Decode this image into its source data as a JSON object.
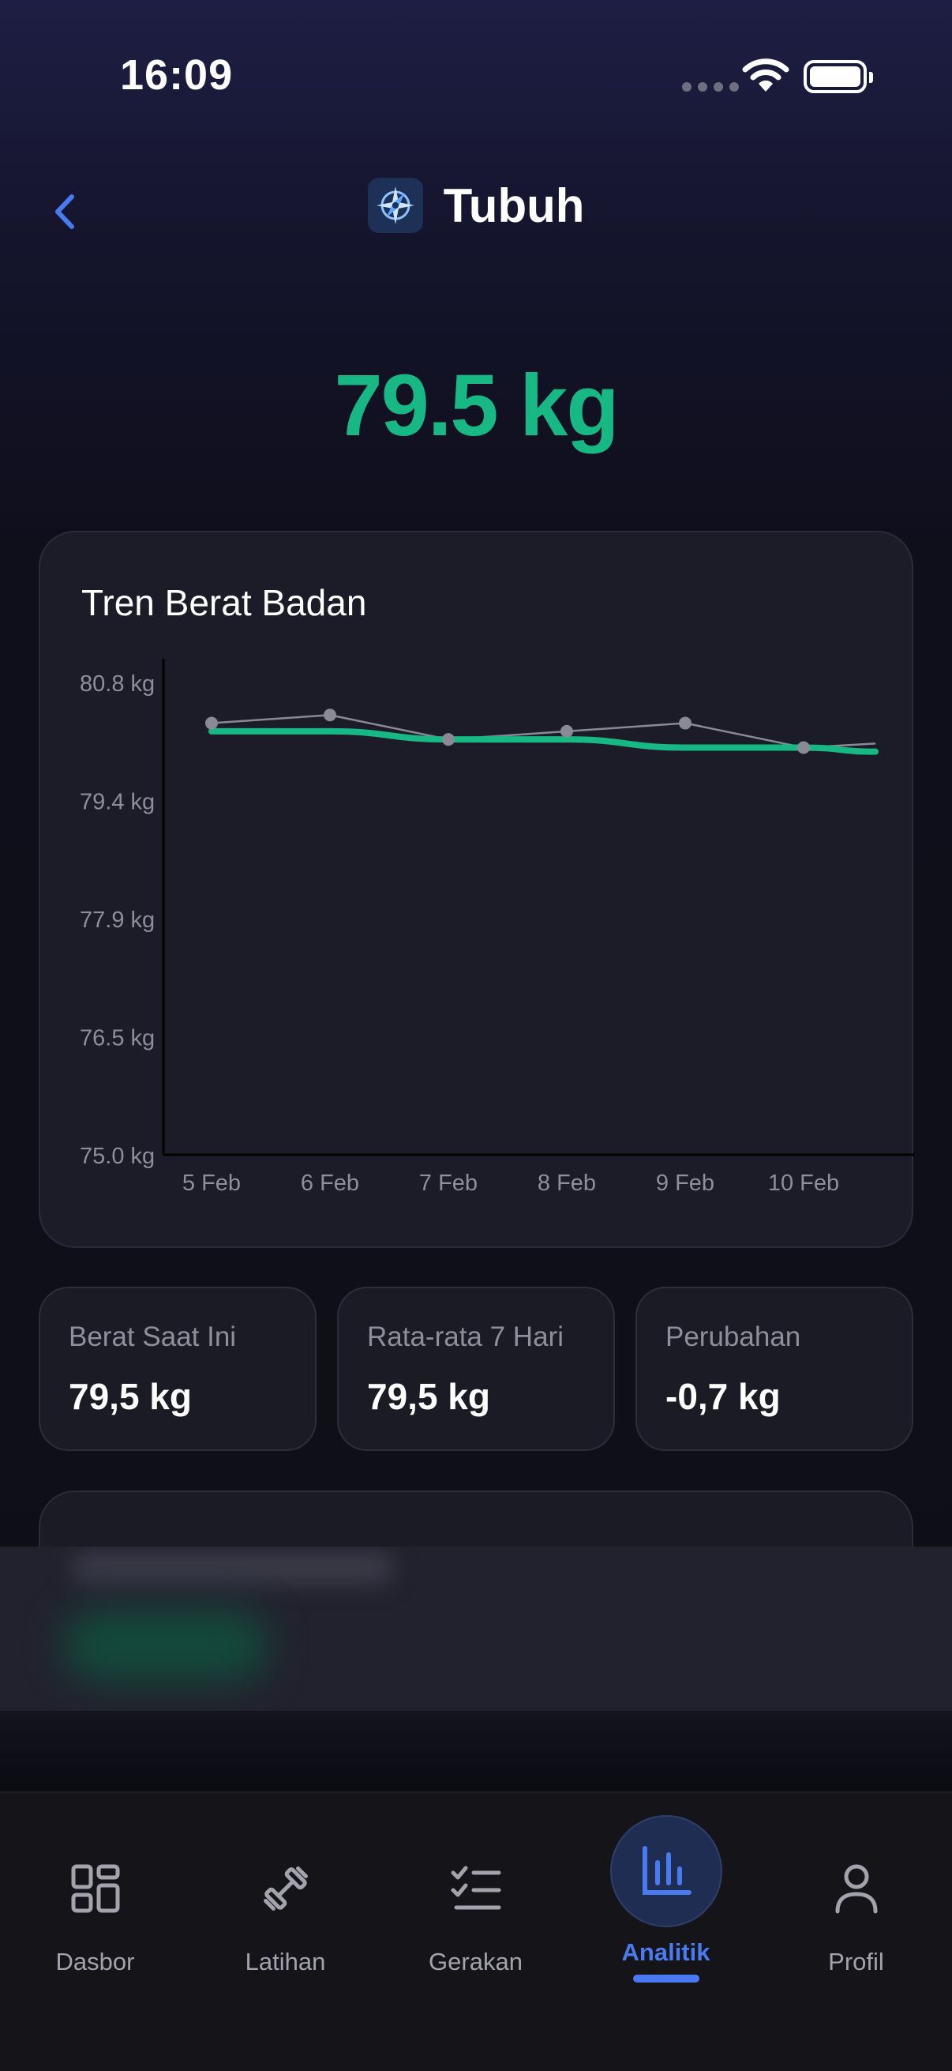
{
  "status_bar": {
    "time": "16:09"
  },
  "header": {
    "title": "Tubuh",
    "logo_icon": "compass-star-icon",
    "back_icon": "chevron-left-icon"
  },
  "hero": {
    "weight": "79.5 kg"
  },
  "colors": {
    "accent_green": "#18b884",
    "accent_blue": "#4a7af0"
  },
  "chart_data": {
    "type": "line",
    "title": "Tren Berat Badan",
    "x": [
      "5 Feb",
      "6 Feb",
      "7 Feb",
      "8 Feb",
      "9 Feb",
      "10 Feb"
    ],
    "y_tick_labels": [
      "80.8 kg",
      "79.4 kg",
      "77.9 kg",
      "76.5 kg",
      "75.0 kg"
    ],
    "ylim": [
      75.0,
      80.8
    ],
    "grid": false,
    "series": [
      {
        "role": "daily",
        "color": "#8a8a96",
        "x": [
          "5 Feb",
          "6 Feb",
          "7 Feb",
          "8 Feb",
          "9 Feb",
          "10 Feb"
        ],
        "values": [
          80.3,
          80.4,
          80.1,
          80.2,
          80.3,
          80.0
        ],
        "trailing_value": 80.05
      },
      {
        "role": "trend",
        "color": "#18b884",
        "x": [
          "5 Feb",
          "6 Feb",
          "7 Feb",
          "8 Feb",
          "9 Feb",
          "10 Feb"
        ],
        "values": [
          80.2,
          80.2,
          80.1,
          80.1,
          80.0,
          80.0
        ],
        "trailing_value": 79.95
      }
    ]
  },
  "stats": [
    {
      "label": "Berat Saat Ini",
      "value": "79,5 kg"
    },
    {
      "label": "Rata-rata 7 Hari",
      "value": "79,5 kg"
    },
    {
      "label": "Perubahan",
      "value": "-0,7 kg"
    }
  ],
  "tabs": [
    {
      "label": "Dasbor",
      "icon": "dashboard-grid-icon",
      "active": false
    },
    {
      "label": "Latihan",
      "icon": "dumbbell-icon",
      "active": false
    },
    {
      "label": "Gerakan",
      "icon": "checklist-icon",
      "active": false
    },
    {
      "label": "Analitik",
      "icon": "bar-chart-icon",
      "active": true
    },
    {
      "label": "Profil",
      "icon": "person-icon",
      "active": false
    }
  ]
}
